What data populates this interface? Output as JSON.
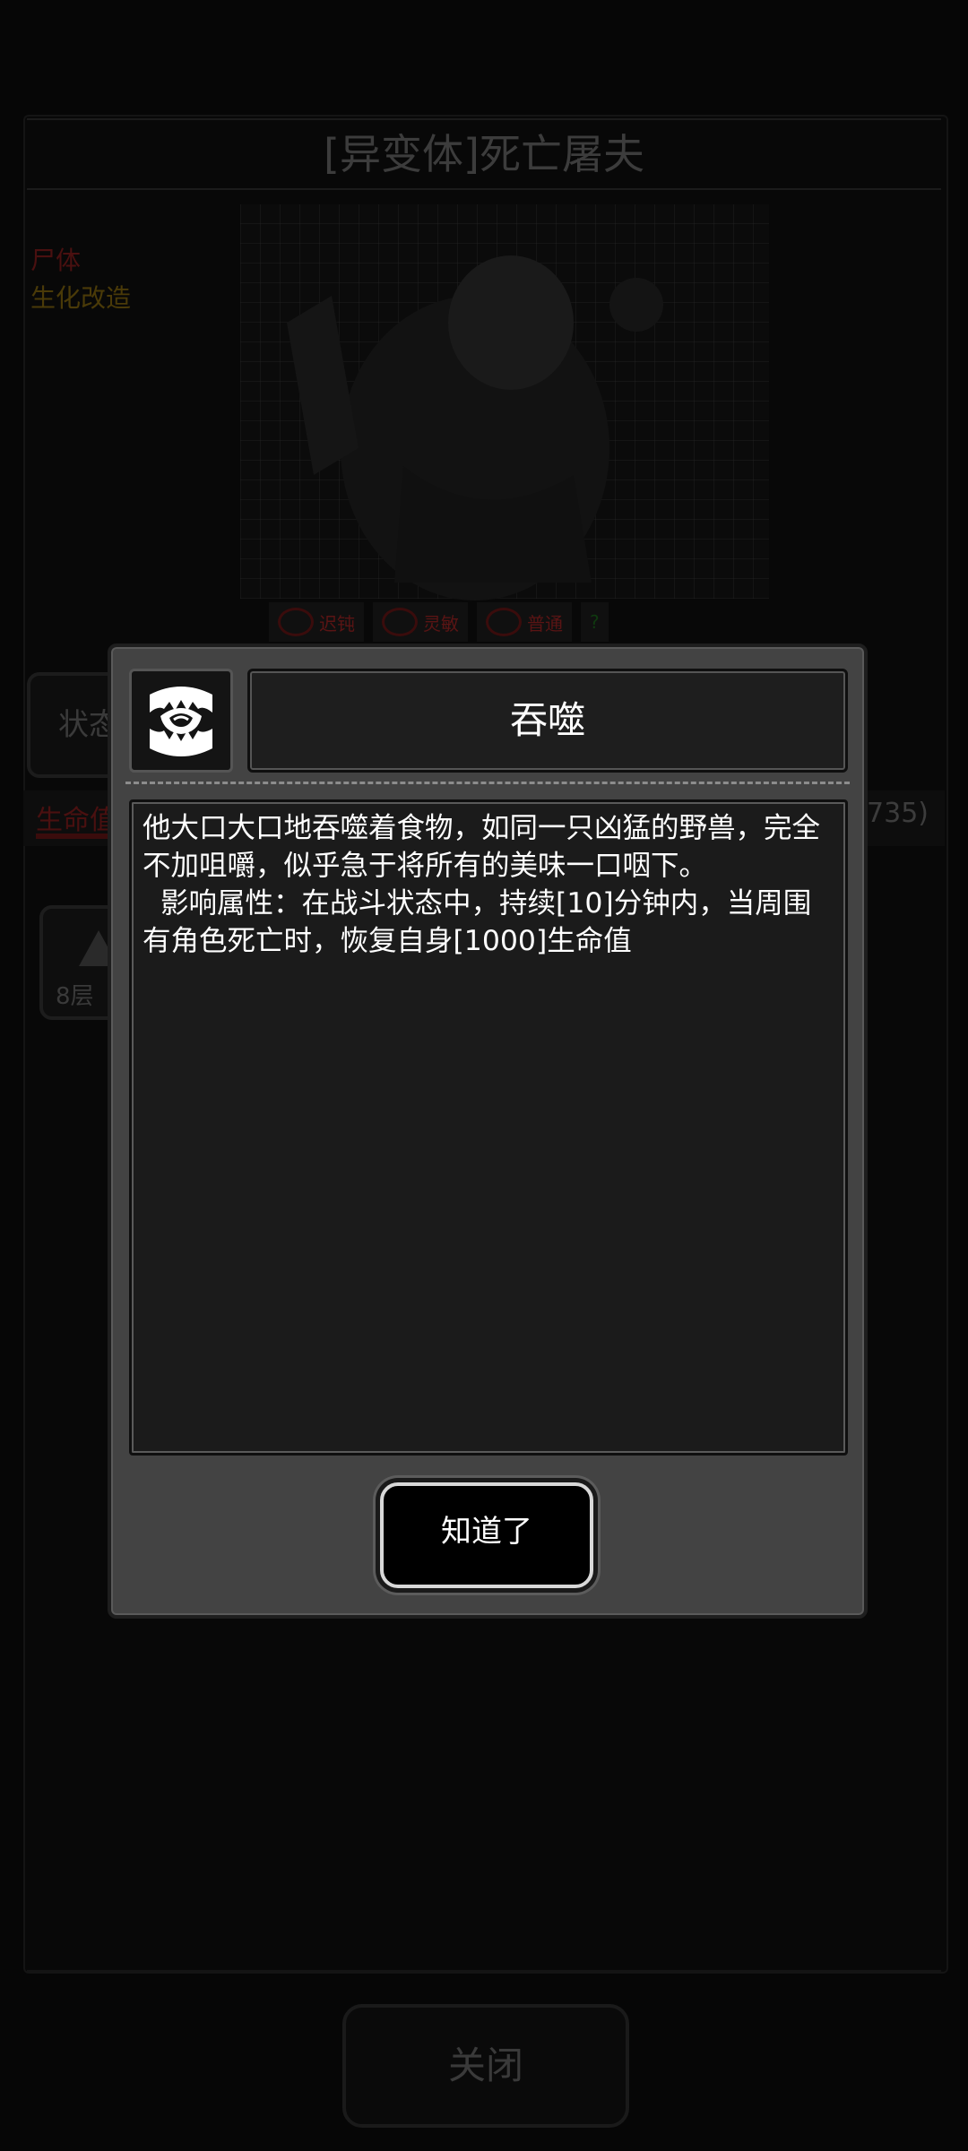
{
  "background": {
    "monster_title": "[异变体]死亡屠夫",
    "left_lines": [
      "尸体",
      "生化改造"
    ],
    "tags": [
      "迟钝",
      "灵敏",
      "普通",
      ""
    ],
    "state_tab": "状态",
    "hp_label": "生命值",
    "hp_value": "2735)",
    "buff_label": "8层",
    "close_label": "关闭"
  },
  "dialog": {
    "icon": "devour-mouth-icon",
    "title": "吞噬",
    "description": "他大口大口地吞噬着食物，如同一只凶猛的野兽，完全不加咀嚼，似乎急于将所有的美味一口咽下。\n  影响属性：在战斗状态中，持续[10]分钟内，当周围有角色死亡时，恢复自身[1000]生命值",
    "ok_label": "知道了"
  },
  "colors": {
    "dialog_bg": "#434343",
    "panel_bg": "#1b1b1b",
    "text": "#ffffff",
    "overlay_red": "#4a1010"
  }
}
